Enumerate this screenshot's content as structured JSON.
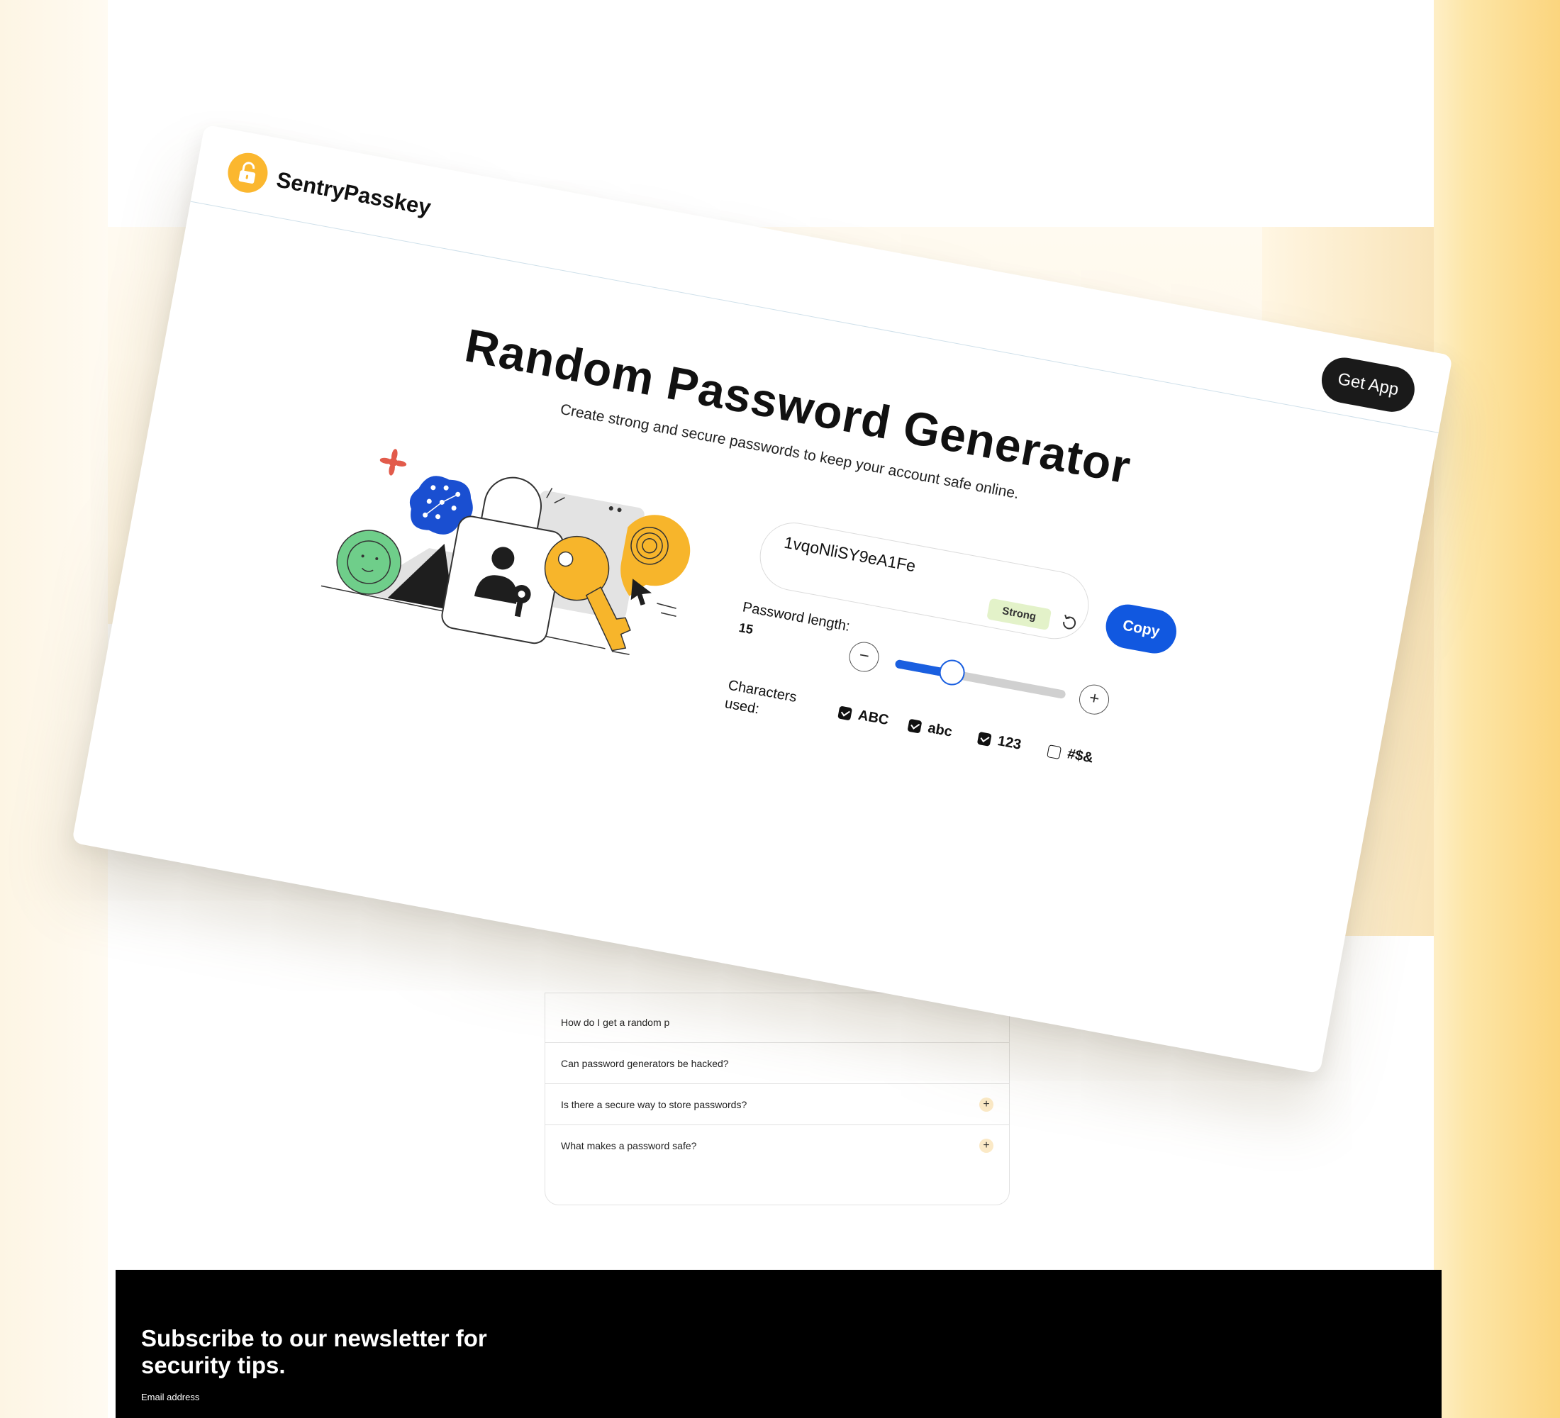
{
  "app": {
    "brand": "SentryPasskey",
    "get_app_label": "Get App"
  },
  "hero": {
    "title": "Random Password Generator",
    "subtitle": "Create strong and secure passwords to keep your account safe online."
  },
  "generator": {
    "password": "1vqoNliSY9eA1Fe",
    "strength": "Strong",
    "copy_label": "Copy",
    "length_label": "Password length:",
    "length_value": "15",
    "length_fraction": 0.33,
    "characters_label": "Characters used:",
    "options": [
      {
        "label": "ABC",
        "checked": true
      },
      {
        "label": "abc",
        "checked": true
      },
      {
        "label": "123",
        "checked": true
      },
      {
        "label": "#$&",
        "checked": false
      }
    ]
  },
  "faq": {
    "items": [
      {
        "question": "How do I get a random p"
      },
      {
        "question": "Can password generators be hacked?"
      },
      {
        "question": "Is there a secure way to store passwords?"
      },
      {
        "question": "What makes a password safe?"
      }
    ]
  },
  "footer": {
    "newsletter_title": "Subscribe to our newsletter for security tips.",
    "email_label": "Email address"
  },
  "colors": {
    "accent_blue": "#1158e0",
    "brand_yellow": "#fbb72f",
    "strength_green": "#e3f2c9"
  },
  "icons": {
    "logo": "lock-icon",
    "refresh": "refresh-icon",
    "minus": "minus-icon",
    "plus": "plus-icon"
  }
}
